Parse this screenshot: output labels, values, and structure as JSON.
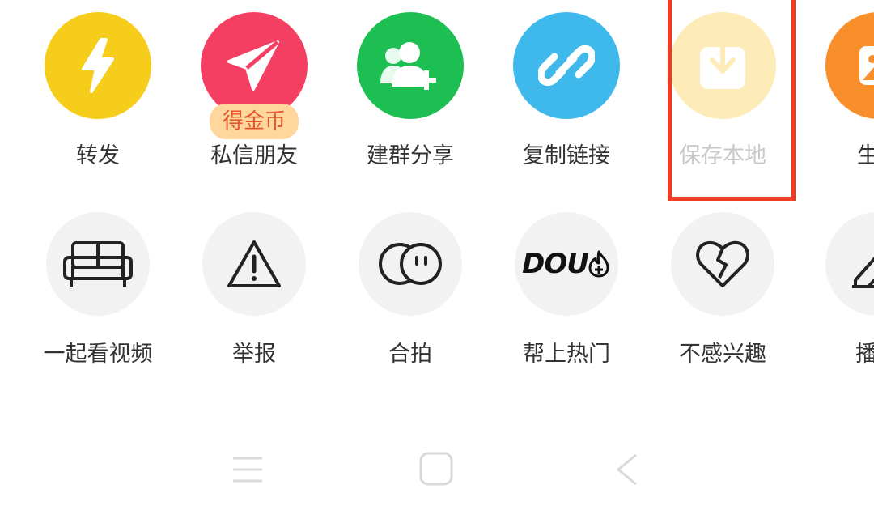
{
  "share_row": [
    {
      "label": "转发",
      "icon": "lightning-icon",
      "color": "#f7cd1b"
    },
    {
      "label": "私信朋友",
      "icon": "paper-plane-icon",
      "color": "#f43f63",
      "badge": "得金币"
    },
    {
      "label": "建群分享",
      "icon": "add-group-icon",
      "color": "#1dbf52"
    },
    {
      "label": "复制链接",
      "icon": "link-icon",
      "color": "#3fb8ec"
    },
    {
      "label": "保存本地",
      "icon": "download-icon",
      "color": "#fdecb7"
    },
    {
      "label": "生成",
      "icon": "image-icon",
      "color": "#f98f2a"
    }
  ],
  "action_row": [
    {
      "label": "一起看视频",
      "icon": "sofa-icon"
    },
    {
      "label": "举报",
      "icon": "warning-icon"
    },
    {
      "label": "合拍",
      "icon": "duet-icon"
    },
    {
      "label": "帮上热门",
      "icon": "dou-plus-icon",
      "logo_text": "DOU"
    },
    {
      "label": "不感兴趣",
      "icon": "broken-heart-icon"
    },
    {
      "label": "播放",
      "icon": "edit-icon"
    }
  ],
  "nav": {
    "menu": "menu-icon",
    "home": "home-icon",
    "back": "back-icon"
  }
}
